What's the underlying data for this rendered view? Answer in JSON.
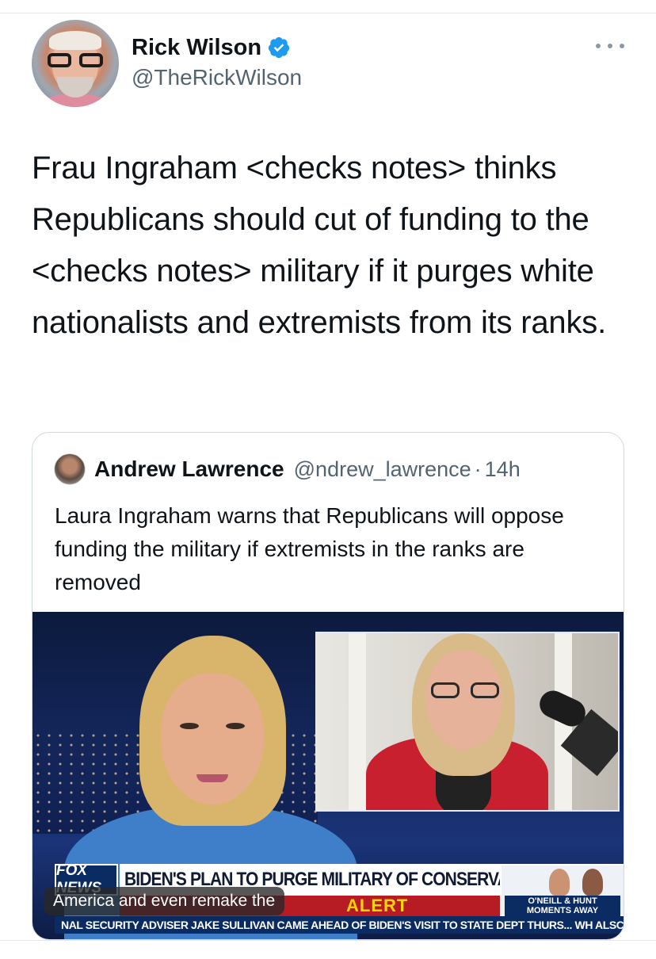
{
  "tweet": {
    "author_name": "Rick Wilson",
    "author_handle": "@TheRickWilson",
    "text": "Frau Ingraham <checks notes> thinks Republicans should cut of funding to the <checks notes> military if it purges white nationalists and extremists from its ranks.",
    "icons": [
      "verified-badge-icon",
      "more-options-icon"
    ],
    "colors": {
      "verified": "#1d9bf0",
      "secondary_text": "#536471",
      "border": "#cfd9de"
    }
  },
  "quote": {
    "author_name": "Andrew Lawrence",
    "author_handle": "@ndrew_lawrence",
    "separator": "·",
    "time": "14h",
    "text": "Laura Ingraham warns that Republicans will oppose funding the military if extremists in the ranks are removed"
  },
  "media": {
    "network_logo": "FOX NEWS",
    "headline": "BIDEN'S PLAN TO PURGE MILITARY OF CONSERVATIVES",
    "alert": "ALERT",
    "promo": "O'NEILL & HUNT MOMENTS AWAY",
    "ticker": "NAL SECURITY ADVISER JAKE SULLIVAN CAME AHEAD OF BIDEN'S VISIT TO STATE DEPT THURS...   WH ALSC",
    "caption": "America and even remake the"
  }
}
